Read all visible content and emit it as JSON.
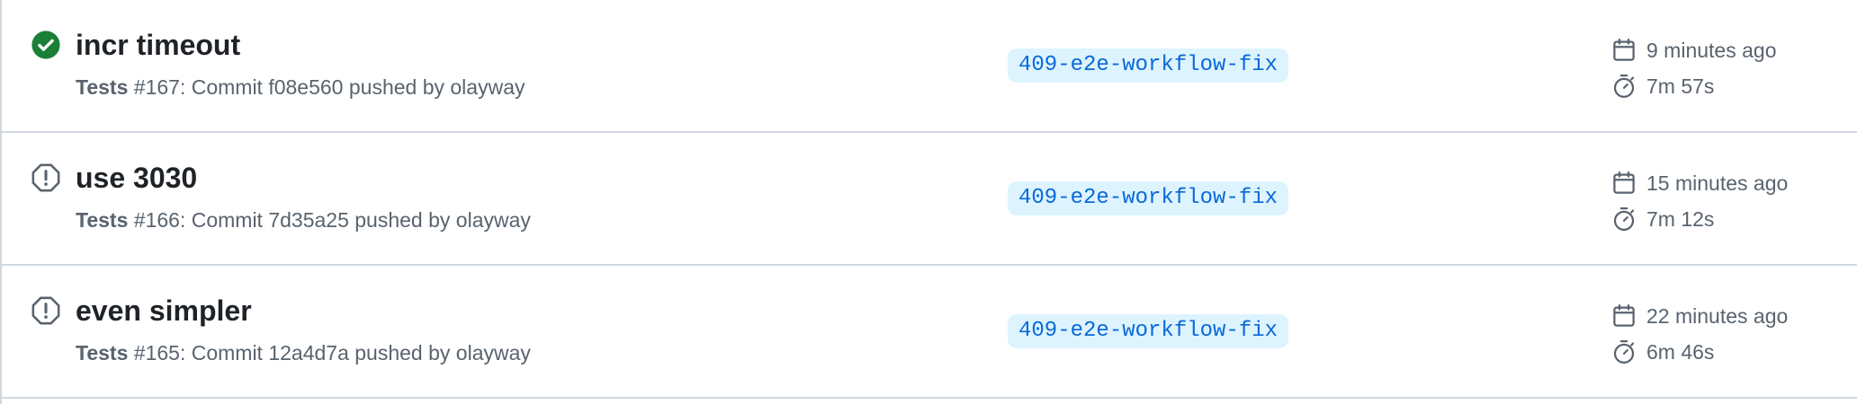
{
  "runs": [
    {
      "status": "success",
      "title": "incr timeout",
      "workflow": "Tests",
      "meta_rest": " #167: Commit f08e560 pushed by olayway",
      "branch": "409-e2e-workflow-fix",
      "time_ago": "9 minutes ago",
      "duration": "7m 57s"
    },
    {
      "status": "cancelled",
      "title": "use 3030",
      "workflow": "Tests",
      "meta_rest": " #166: Commit 7d35a25 pushed by olayway",
      "branch": "409-e2e-workflow-fix",
      "time_ago": "15 minutes ago",
      "duration": "7m 12s"
    },
    {
      "status": "cancelled",
      "title": "even simpler",
      "workflow": "Tests",
      "meta_rest": " #165: Commit 12a4d7a pushed by olayway",
      "branch": "409-e2e-workflow-fix",
      "time_ago": "22 minutes ago",
      "duration": "6m 46s"
    }
  ],
  "icons": {
    "success": "check-circle-fill-icon",
    "cancelled": "stop-octagon-icon",
    "calendar": "calendar-icon",
    "stopwatch": "stopwatch-icon"
  },
  "colors": {
    "success": "#1a7f37",
    "neutral_icon": "#59636e",
    "branch_bg": "#ddf4ff",
    "branch_text": "#0969da",
    "border": "#d0d7de"
  }
}
